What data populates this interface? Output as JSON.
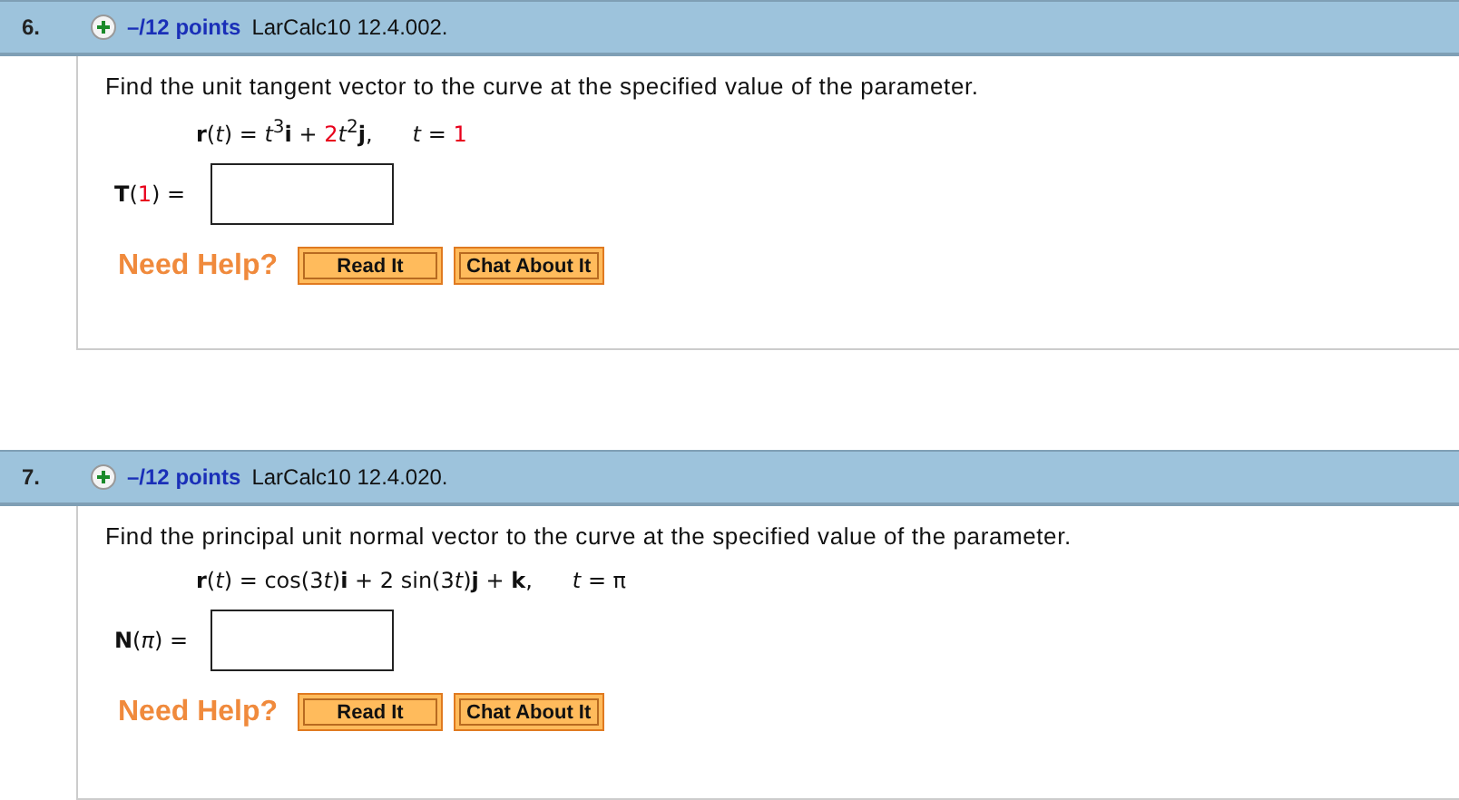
{
  "questions": [
    {
      "number": "6.",
      "points": "–/12 points",
      "source": "LarCalc10 12.4.002.",
      "prompt": "Find the unit tangent vector to the curve at the specified value of the parameter.",
      "formula": [
        {
          "text": "**r**(*t*) = *t*$^{3}$**i** + ",
          "randomized": false
        },
        {
          "text": "2",
          "randomized": true
        },
        {
          "text": "*t*$^{2}$**j**,",
          "randomized": false
        }
      ],
      "parameter": [
        {
          "text": "*t* = ",
          "randomized": false
        },
        {
          "text": "1",
          "randomized": true
        }
      ],
      "answer_label": [
        {
          "text": "**T**(",
          "randomized": false
        },
        {
          "text": "1",
          "randomized": true
        },
        {
          "text": ") =",
          "randomized": false
        }
      ],
      "help_label": "Need Help?",
      "buttons": [
        "Read It",
        "Chat About It"
      ]
    },
    {
      "number": "7.",
      "points": "–/12 points",
      "source": "LarCalc10 12.4.020.",
      "prompt": "Find the principal unit normal vector to the curve at the specified value of the parameter.",
      "formula": [
        {
          "text": "**r**(*t*) = cos(3",
          "randomized": false
        },
        {
          "text": "*t*)**i** + 2 sin(3",
          "randomized": false
        },
        {
          "text": "*t*)**j** + **k**,",
          "randomized": false
        }
      ],
      "parameter": [
        {
          "text": "*t* = π",
          "randomized": false
        }
      ],
      "answer_label": [
        {
          "text": "**N**(*π*) =",
          "randomized": false
        }
      ],
      "help_label": "Need Help?",
      "buttons": [
        "Read It",
        "Chat About It"
      ]
    }
  ]
}
